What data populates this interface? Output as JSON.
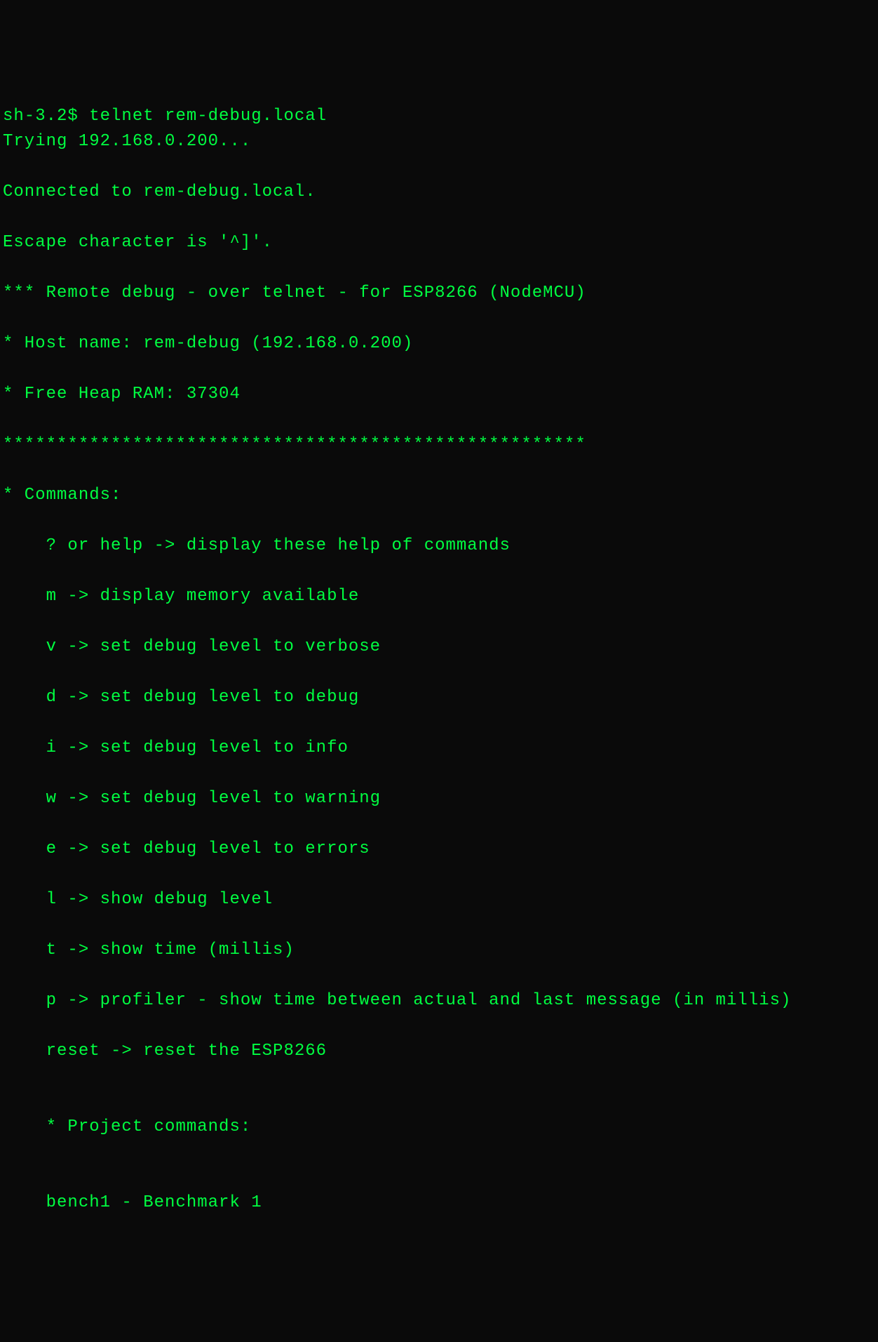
{
  "terminal": {
    "prompt": "sh-3.2$ ",
    "command": "telnet rem-debug.local",
    "lines": [
      "Trying 192.168.0.200...",
      "Connected to rem-debug.local.",
      "Escape character is '^]'.",
      "*** Remote debug - over telnet - for ESP8266 (NodeMCU)",
      "* Host name: rem-debug (192.168.0.200)",
      "* Free Heap RAM: 37304",
      "******************************************************",
      "* Commands:",
      "    ? or help -> display these help of commands",
      "    m -> display memory available",
      "    v -> set debug level to verbose",
      "    d -> set debug level to debug",
      "    i -> set debug level to info",
      "    w -> set debug level to warning",
      "    e -> set debug level to errors",
      "    l -> show debug level",
      "    t -> show time (millis)",
      "    p -> profiler - show time between actual and last message (in millis)",
      "    reset -> reset the ESP8266",
      "",
      "    * Project commands:",
      "",
      "    bench1 - Benchmark 1"
    ]
  }
}
